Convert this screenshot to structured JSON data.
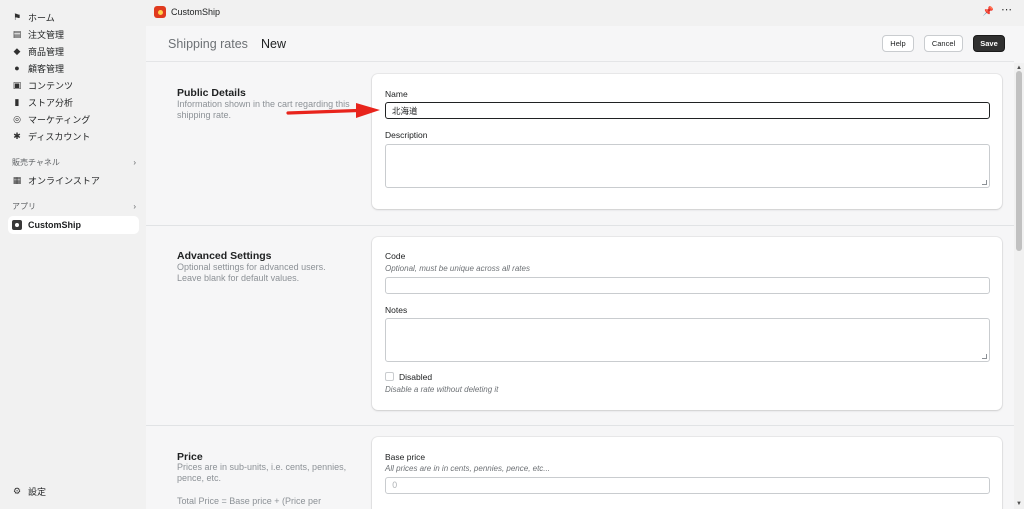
{
  "sidebar": {
    "items": [
      {
        "label": "ホーム",
        "icon": "home-icon"
      },
      {
        "label": "注文管理",
        "icon": "inbox-icon"
      },
      {
        "label": "商品管理",
        "icon": "tag-icon"
      },
      {
        "label": "顧客管理",
        "icon": "person-icon"
      },
      {
        "label": "コンテンツ",
        "icon": "content-icon"
      },
      {
        "label": "ストア分析",
        "icon": "bar-chart-icon"
      },
      {
        "label": "マーケティング",
        "icon": "target-icon"
      },
      {
        "label": "ディスカウント",
        "icon": "discount-icon"
      }
    ],
    "sales_channels_label": "販売チャネル",
    "online_store_label": "オンラインストア",
    "apps_label": "アプリ",
    "active_app_label": "CustomShip",
    "settings_label": "設定"
  },
  "topbar": {
    "app_title": "CustomShip"
  },
  "header": {
    "breadcrumb": "Shipping rates",
    "title": "New",
    "help_label": "Help",
    "cancel_label": "Cancel",
    "save_label": "Save"
  },
  "public_details": {
    "title": "Public Details",
    "description": "Information shown in the cart regarding this shipping rate.",
    "name_label": "Name",
    "name_value": "北海道",
    "description_label": "Description",
    "description_value": ""
  },
  "advanced_settings": {
    "title": "Advanced Settings",
    "description": "Optional settings for advanced users. Leave blank for default values.",
    "code_label": "Code",
    "code_hint": "Optional, must be unique across all rates",
    "code_value": "",
    "notes_label": "Notes",
    "notes_value": "",
    "disabled_label": "Disabled",
    "disabled_hint": "Disable a rate without deleting it",
    "disabled_checked": false
  },
  "price": {
    "title": "Price",
    "description": "Prices are in sub-units, i.e. cents, pennies, pence, etc.",
    "formula": "Total Price = Base price + (Price per",
    "base_price_label": "Base price",
    "base_price_hint": "All prices are in in cents, pennies, pence, etc...",
    "base_price_placeholder": "0"
  },
  "colors": {
    "accent_arrow": "#e8241c",
    "save_button": "#303030"
  }
}
